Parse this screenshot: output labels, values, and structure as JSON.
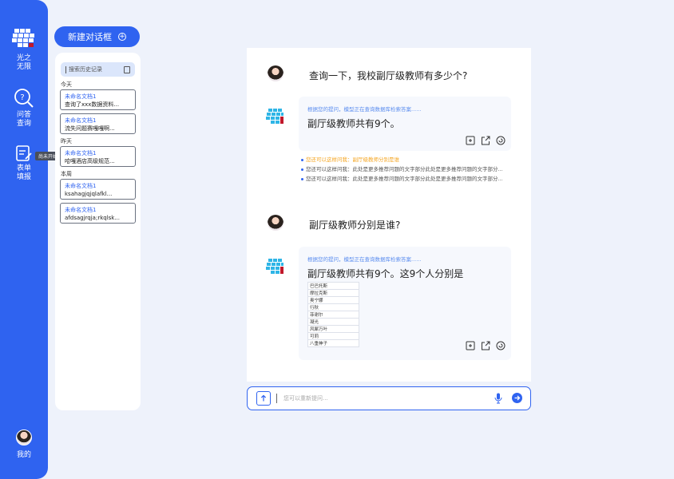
{
  "rail": {
    "brand_line1": "光之",
    "brand_line2": "无限",
    "nav": [
      {
        "label1": "问答",
        "label2": "查询"
      },
      {
        "label1": "表单",
        "label2": "填报"
      }
    ],
    "hint": "尚未开始",
    "me_label": "我的"
  },
  "sidebar": {
    "new_chat": "新建对话框",
    "search_placeholder": "搜索历史记录",
    "groups": {
      "today": "今天",
      "yesterday": "昨天",
      "week": "本周"
    },
    "history": [
      {
        "title": "未命名文档1",
        "snippet": "查询了xxx数据资料..."
      },
      {
        "title": "未命名文档1",
        "snippet": "流失问题赛嘎嘎啊..."
      },
      {
        "title": "未命名文档1",
        "snippet": "哈嘎酒店高级规范..."
      },
      {
        "title": "未命名文档1",
        "snippet": "ksahagjqjqlafkl..."
      },
      {
        "title": "未命名文档1",
        "snippet": "afdsagjrqja;rkqlsk..."
      }
    ]
  },
  "chat": {
    "q1": "查询一下，我校副厅级教师有多少个?",
    "a1_status": "根据您的提问，模型正在查询数据库检索答案......",
    "a1_text": "副厅级教师共有9个。",
    "suggestions": [
      "您还可以这样问我：副厅级教师分别是谁",
      "您还可以这样问我：此处是更多推荐问题的文字部分此处是更多推荐问题的文字部分...",
      "您还可以这样问我：此处是更多推荐问题的文字部分此处是更多推荐问题的文字部分..."
    ],
    "q2": "副厅级教师分别是谁?",
    "a2_status": "根据您的提问，模型正在查询数据库检索答案......",
    "a2_text": "副厅级教师共有9个。这9个人分别是",
    "table": [
      "巴巴托斯",
      "摩拉克斯",
      "奥宁娜",
      "行秋",
      "菲谢尔",
      "凝光",
      "风犀万叶",
      "可莉",
      "八重神子"
    ]
  },
  "input": {
    "placeholder": "您可以重新提问..."
  },
  "colors": {
    "accent": "#2f63f0",
    "suggestion_highlight": "#f5a623"
  },
  "icons": [
    "grid-logo-icon",
    "search-qa-icon",
    "form-edit-icon",
    "plus-circle-icon",
    "document-icon",
    "copy-icon",
    "share-icon",
    "refresh-icon",
    "upload-icon",
    "mic-icon",
    "send-icon"
  ]
}
